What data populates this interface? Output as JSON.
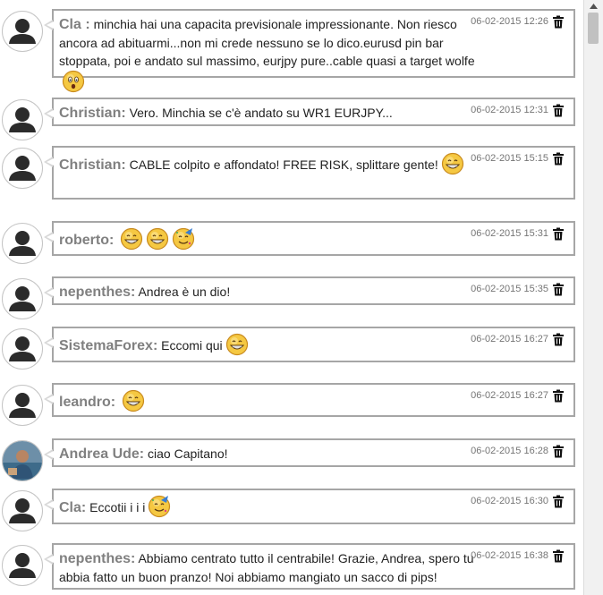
{
  "messages": [
    {
      "author": "Cla ",
      "text": "minchia hai una capacita previsionale impressionante. Non riesco ancora ad abituarmi...non mi crede nessuno se lo dico.eurusd pin bar stoppata, poi e andato sul massimo, eurjpy pure..cable quasi a target wolfe",
      "time": "06-02-2015 12:26",
      "emoticons": [
        "surprised"
      ],
      "avatar": "default"
    },
    {
      "author": "Christian",
      "text": "Vero. Minchia se c'è andato su WR1 EURJPY...",
      "time": "06-02-2015 12:31",
      "emoticons": [],
      "avatar": "default"
    },
    {
      "author": "Christian",
      "text": "CABLE colpito e affondato! FREE RISK, splittare gente!",
      "time": "06-02-2015 15:15",
      "emoticons": [
        "grin"
      ],
      "avatar": "default"
    },
    {
      "author": "roberto",
      "text": "",
      "time": "06-02-2015 15:31",
      "emoticons": [
        "grin",
        "grin",
        "party"
      ],
      "avatar": "default"
    },
    {
      "author": "nepenthes",
      "text": "Andrea è un dio!",
      "time": "06-02-2015 15:35",
      "emoticons": [],
      "avatar": "default"
    },
    {
      "author": "SistemaForex",
      "text": "Eccomi qui",
      "time": "06-02-2015 16:27",
      "emoticons": [
        "grin"
      ],
      "avatar": "default"
    },
    {
      "author": "leandro",
      "text": "",
      "time": "06-02-2015 16:27",
      "emoticons": [
        "grin"
      ],
      "avatar": "default"
    },
    {
      "author": "Andrea Ude",
      "text": "ciao Capitano!",
      "time": "06-02-2015 16:28",
      "emoticons": [],
      "avatar": "photo"
    },
    {
      "author": "Cla",
      "text": "Eccotii i i i",
      "time": "06-02-2015 16:30",
      "emoticons": [
        "party"
      ],
      "avatar": "default"
    },
    {
      "author": "nepenthes",
      "text": "Abbiamo centrato tutto il centrabile! Grazie, Andrea, spero tu abbia fatto un buon pranzo! Noi abbiamo mangiato un sacco di pips!",
      "time": "06-02-2015 16:38",
      "emoticons": [],
      "avatar": "default"
    }
  ],
  "icons": {
    "delete": "trash-icon",
    "avatar_default": "user-silhouette-icon",
    "avatar_photo": "user-photo-icon"
  },
  "colors": {
    "border": "#a6a6a6",
    "author": "#808080",
    "time": "#757575",
    "emoticon": "#f5c842"
  }
}
